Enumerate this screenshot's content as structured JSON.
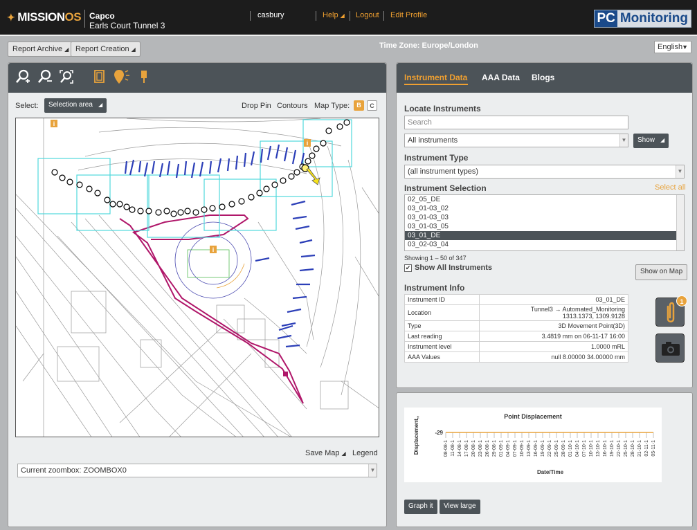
{
  "header": {
    "logo_main": "MISSION",
    "logo_accent": "OS",
    "client_name": "Capco",
    "project_name": "Earls Court Tunnel 3",
    "username": "casbury",
    "help": "Help",
    "logout": "Logout",
    "edit_profile": "Edit Profile",
    "brand_pc": "PC",
    "brand_monitoring": "Monitoring"
  },
  "toolbar": {
    "report_archive": "Report Archive",
    "report_creation": "Report Creation",
    "timezone": "Time Zone: Europe/London",
    "language": "English"
  },
  "map_panel": {
    "select_label": "Select:",
    "selection_mode": "Selection area",
    "drop_pin": "Drop Pin",
    "contours": "Contours",
    "map_type_label": "Map Type:",
    "map_type_b": "B",
    "map_type_c": "C",
    "save_map": "Save Map",
    "legend": "Legend",
    "zoombox": "Current zoombox: ZOOMBOX0"
  },
  "right_panel": {
    "tabs": [
      "Instrument Data",
      "AAA Data",
      "Blogs"
    ],
    "locate_title": "Locate Instruments",
    "search_placeholder": "Search",
    "instrument_filter": "All instruments",
    "show_button": "Show",
    "type_title": "Instrument Type",
    "type_value": "(all instrument types)",
    "selection_title": "Instrument Selection",
    "select_all": "Select all",
    "instruments": [
      "02_05_DE",
      "03_01-03_02",
      "03_01-03_03",
      "03_01-03_05",
      "03_01_DE",
      "03_02-03_04"
    ],
    "selected_instrument": "03_01_DE",
    "showing": "Showing 1 – 50 of 347",
    "show_all_label": "Show All Instruments",
    "show_all_checked": true,
    "show_on_map": "Show on Map",
    "info_title": "Instrument Info",
    "info": [
      {
        "label": "Instrument ID",
        "value": "03_01_DE"
      },
      {
        "label": "Location",
        "value": "Tunnel3 → Automated_Monitoring",
        "value2": "1313.1373, 1309.9128"
      },
      {
        "label": "Type",
        "value": "3D Movement Point(3D)"
      },
      {
        "label": "Last reading",
        "value": "3.4819 mm on 06-11-17 16:00"
      },
      {
        "label": "Instrument level",
        "value": "1.0000 mRL"
      },
      {
        "label": "AAA Values",
        "value": "null 8.00000 34.00000 mm"
      }
    ],
    "attachment_count": "1",
    "colors": {
      "accent": "#e8a33c",
      "header": "#4c5358"
    }
  },
  "graph_panel": {
    "graph_it": "Graph it",
    "view_large": "View large",
    "chart_data": {
      "type": "line",
      "title": "Point Displacement",
      "ylabel": "Displacement,,",
      "xlabel": "Date/Time",
      "yticks": [
        "-29"
      ],
      "x": [
        "08-08-1",
        "11-08-1",
        "14-08-1",
        "17-08-1",
        "20-08-1",
        "23-08-1",
        "26-08-1",
        "29-08-1",
        "01-09-1",
        "04-09-1",
        "07-09-1",
        "10-09-1",
        "13-09-1",
        "16-09-1",
        "19-09-1",
        "22-09-1",
        "25-09-1",
        "28-09-1",
        "01-10-1",
        "04-10-1",
        "07-10-1",
        "10-10-1",
        "13-10-1",
        "16-10-1",
        "19-10-1",
        "22-10-1",
        "25-10-1",
        "28-10-1",
        "31-10-1",
        "02-11-1",
        "05-11-1"
      ],
      "series": [
        {
          "values": [
            -29,
            -29,
            -29,
            -29,
            -29,
            -29,
            -29,
            -29,
            -29,
            -29,
            -29,
            -29,
            -29,
            -29,
            -29,
            -29,
            -29,
            -29,
            -29,
            -29,
            -29,
            -29,
            -29,
            -29,
            -29,
            -29,
            -29,
            -29,
            -29,
            -29,
            -29
          ],
          "color": "#e8a33c"
        }
      ]
    }
  }
}
